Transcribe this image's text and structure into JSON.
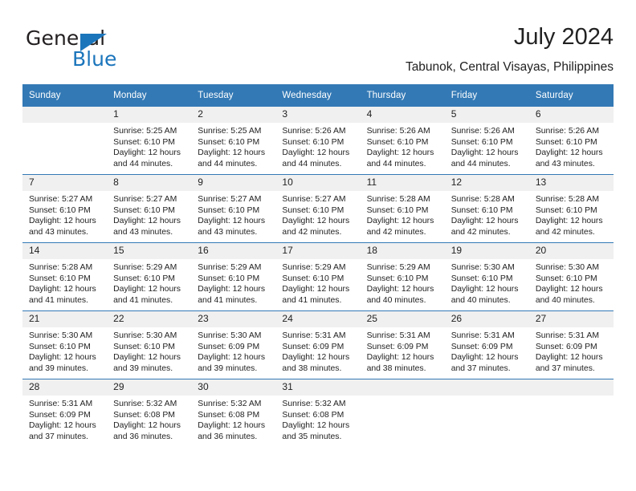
{
  "brand": {
    "name_part1": "General",
    "name_part2": "Blue",
    "triangle_icon": "triangle-icon",
    "accent_color": "#1b75bb"
  },
  "header": {
    "title": "July 2024",
    "subtitle": "Tabunok, Central Visayas, Philippines"
  },
  "calendar": {
    "header_bg": "#3379b5",
    "daynum_bg": "#f0f0f0",
    "weekday_headers": [
      "Sunday",
      "Monday",
      "Tuesday",
      "Wednesday",
      "Thursday",
      "Friday",
      "Saturday"
    ],
    "labels": {
      "sunrise": "Sunrise:",
      "sunset": "Sunset:",
      "daylight": "Daylight:"
    },
    "weeks": [
      [
        {
          "day": "",
          "sunrise": "",
          "sunset": "",
          "daylight": ""
        },
        {
          "day": "1",
          "sunrise": "Sunrise: 5:25 AM",
          "sunset": "Sunset: 6:10 PM",
          "daylight": "Daylight: 12 hours and 44 minutes."
        },
        {
          "day": "2",
          "sunrise": "Sunrise: 5:25 AM",
          "sunset": "Sunset: 6:10 PM",
          "daylight": "Daylight: 12 hours and 44 minutes."
        },
        {
          "day": "3",
          "sunrise": "Sunrise: 5:26 AM",
          "sunset": "Sunset: 6:10 PM",
          "daylight": "Daylight: 12 hours and 44 minutes."
        },
        {
          "day": "4",
          "sunrise": "Sunrise: 5:26 AM",
          "sunset": "Sunset: 6:10 PM",
          "daylight": "Daylight: 12 hours and 44 minutes."
        },
        {
          "day": "5",
          "sunrise": "Sunrise: 5:26 AM",
          "sunset": "Sunset: 6:10 PM",
          "daylight": "Daylight: 12 hours and 44 minutes."
        },
        {
          "day": "6",
          "sunrise": "Sunrise: 5:26 AM",
          "sunset": "Sunset: 6:10 PM",
          "daylight": "Daylight: 12 hours and 43 minutes."
        }
      ],
      [
        {
          "day": "7",
          "sunrise": "Sunrise: 5:27 AM",
          "sunset": "Sunset: 6:10 PM",
          "daylight": "Daylight: 12 hours and 43 minutes."
        },
        {
          "day": "8",
          "sunrise": "Sunrise: 5:27 AM",
          "sunset": "Sunset: 6:10 PM",
          "daylight": "Daylight: 12 hours and 43 minutes."
        },
        {
          "day": "9",
          "sunrise": "Sunrise: 5:27 AM",
          "sunset": "Sunset: 6:10 PM",
          "daylight": "Daylight: 12 hours and 43 minutes."
        },
        {
          "day": "10",
          "sunrise": "Sunrise: 5:27 AM",
          "sunset": "Sunset: 6:10 PM",
          "daylight": "Daylight: 12 hours and 42 minutes."
        },
        {
          "day": "11",
          "sunrise": "Sunrise: 5:28 AM",
          "sunset": "Sunset: 6:10 PM",
          "daylight": "Daylight: 12 hours and 42 minutes."
        },
        {
          "day": "12",
          "sunrise": "Sunrise: 5:28 AM",
          "sunset": "Sunset: 6:10 PM",
          "daylight": "Daylight: 12 hours and 42 minutes."
        },
        {
          "day": "13",
          "sunrise": "Sunrise: 5:28 AM",
          "sunset": "Sunset: 6:10 PM",
          "daylight": "Daylight: 12 hours and 42 minutes."
        }
      ],
      [
        {
          "day": "14",
          "sunrise": "Sunrise: 5:28 AM",
          "sunset": "Sunset: 6:10 PM",
          "daylight": "Daylight: 12 hours and 41 minutes."
        },
        {
          "day": "15",
          "sunrise": "Sunrise: 5:29 AM",
          "sunset": "Sunset: 6:10 PM",
          "daylight": "Daylight: 12 hours and 41 minutes."
        },
        {
          "day": "16",
          "sunrise": "Sunrise: 5:29 AM",
          "sunset": "Sunset: 6:10 PM",
          "daylight": "Daylight: 12 hours and 41 minutes."
        },
        {
          "day": "17",
          "sunrise": "Sunrise: 5:29 AM",
          "sunset": "Sunset: 6:10 PM",
          "daylight": "Daylight: 12 hours and 41 minutes."
        },
        {
          "day": "18",
          "sunrise": "Sunrise: 5:29 AM",
          "sunset": "Sunset: 6:10 PM",
          "daylight": "Daylight: 12 hours and 40 minutes."
        },
        {
          "day": "19",
          "sunrise": "Sunrise: 5:30 AM",
          "sunset": "Sunset: 6:10 PM",
          "daylight": "Daylight: 12 hours and 40 minutes."
        },
        {
          "day": "20",
          "sunrise": "Sunrise: 5:30 AM",
          "sunset": "Sunset: 6:10 PM",
          "daylight": "Daylight: 12 hours and 40 minutes."
        }
      ],
      [
        {
          "day": "21",
          "sunrise": "Sunrise: 5:30 AM",
          "sunset": "Sunset: 6:10 PM",
          "daylight": "Daylight: 12 hours and 39 minutes."
        },
        {
          "day": "22",
          "sunrise": "Sunrise: 5:30 AM",
          "sunset": "Sunset: 6:10 PM",
          "daylight": "Daylight: 12 hours and 39 minutes."
        },
        {
          "day": "23",
          "sunrise": "Sunrise: 5:30 AM",
          "sunset": "Sunset: 6:09 PM",
          "daylight": "Daylight: 12 hours and 39 minutes."
        },
        {
          "day": "24",
          "sunrise": "Sunrise: 5:31 AM",
          "sunset": "Sunset: 6:09 PM",
          "daylight": "Daylight: 12 hours and 38 minutes."
        },
        {
          "day": "25",
          "sunrise": "Sunrise: 5:31 AM",
          "sunset": "Sunset: 6:09 PM",
          "daylight": "Daylight: 12 hours and 38 minutes."
        },
        {
          "day": "26",
          "sunrise": "Sunrise: 5:31 AM",
          "sunset": "Sunset: 6:09 PM",
          "daylight": "Daylight: 12 hours and 37 minutes."
        },
        {
          "day": "27",
          "sunrise": "Sunrise: 5:31 AM",
          "sunset": "Sunset: 6:09 PM",
          "daylight": "Daylight: 12 hours and 37 minutes."
        }
      ],
      [
        {
          "day": "28",
          "sunrise": "Sunrise: 5:31 AM",
          "sunset": "Sunset: 6:09 PM",
          "daylight": "Daylight: 12 hours and 37 minutes."
        },
        {
          "day": "29",
          "sunrise": "Sunrise: 5:32 AM",
          "sunset": "Sunset: 6:08 PM",
          "daylight": "Daylight: 12 hours and 36 minutes."
        },
        {
          "day": "30",
          "sunrise": "Sunrise: 5:32 AM",
          "sunset": "Sunset: 6:08 PM",
          "daylight": "Daylight: 12 hours and 36 minutes."
        },
        {
          "day": "31",
          "sunrise": "Sunrise: 5:32 AM",
          "sunset": "Sunset: 6:08 PM",
          "daylight": "Daylight: 12 hours and 35 minutes."
        },
        {
          "day": "",
          "sunrise": "",
          "sunset": "",
          "daylight": ""
        },
        {
          "day": "",
          "sunrise": "",
          "sunset": "",
          "daylight": ""
        },
        {
          "day": "",
          "sunrise": "",
          "sunset": "",
          "daylight": ""
        }
      ]
    ]
  }
}
